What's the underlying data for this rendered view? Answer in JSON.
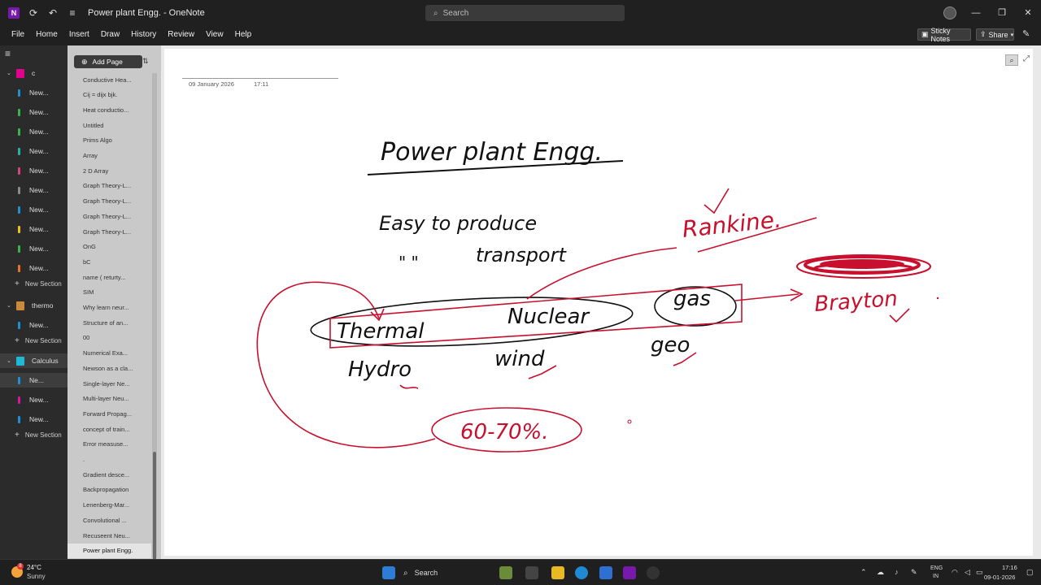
{
  "titlebar": {
    "title": "Power plant Engg. - OneNote",
    "search_placeholder": "Search"
  },
  "menu": [
    "File",
    "Home",
    "Insert",
    "Draw",
    "History",
    "Review",
    "View",
    "Help"
  ],
  "toolbar": {
    "sticky_notes": "Sticky Notes",
    "share": "Share"
  },
  "sections_pane": {
    "notebook_c": {
      "label": "c",
      "color": "#e3008c"
    },
    "c_sections": [
      {
        "label": "New...",
        "color": "#1e90d8"
      },
      {
        "label": "New...",
        "color": "#3cb34a"
      },
      {
        "label": "New...",
        "color": "#3cb34a"
      },
      {
        "label": "New...",
        "color": "#21b3a5"
      },
      {
        "label": "New...",
        "color": "#d9417b"
      },
      {
        "label": "New...",
        "color": "#8a8a8a"
      },
      {
        "label": "New...",
        "color": "#1e90d8"
      },
      {
        "label": "New...",
        "color": "#e6c21b"
      },
      {
        "label": "New...",
        "color": "#3cb34a"
      },
      {
        "label": "New...",
        "color": "#e8722c"
      }
    ],
    "new_section": "New Section",
    "notebook_thermo": {
      "label": "thermo",
      "color": "#c98a3a"
    },
    "thermo_sections": [
      {
        "label": "New...",
        "color": "#1e90d8"
      }
    ],
    "notebook_calculus": {
      "label": "Calculus",
      "color": "#21b8d6"
    },
    "calculus_sections": [
      {
        "label": "Ne...",
        "color": "#1e90d8"
      },
      {
        "label": "New...",
        "color": "#d9179a"
      },
      {
        "label": "New...",
        "color": "#1e90d8"
      }
    ]
  },
  "pages_pane": {
    "add_page": "Add Page",
    "pages": [
      "Conductive Hea...",
      "Cij = dijx bjk.",
      "Heat conductio...",
      "Untitled",
      "Prims Algo",
      "Array",
      "2 D Array",
      "Graph Theory-L...",
      "Graph Theory-L...",
      "Graph Theory-L...",
      "Graph Theory-L...",
      "OnG",
      "bC",
      "name ( returty...",
      "SIM",
      "Why learn neur...",
      "Structure of an...",
      "00",
      "Numerical Exa...",
      "Newson as a cla...",
      "Single-layer Ne...",
      "Multi-layer Neu...",
      "Forward Propag...",
      "concept of train...",
      "Error measuse...",
      ".",
      "Gradient desce...",
      "Backpropagation",
      "Lenenberg-Mar...",
      "Convolutional ...",
      "Recuseent Neu...",
      "Power plant Engg."
    ],
    "selected_index": 31
  },
  "note": {
    "date": "09 January 2026",
    "time": "17:11",
    "ink_text": {
      "title": "Power plant Engg.",
      "line1": "Easy to produce",
      "line2_mark": "\" \"",
      "line2": "transport",
      "thermal": "Thermal",
      "nuclear": "Nuclear",
      "gas": "gas",
      "hydro": "Hydro",
      "wind": "wind",
      "geo": "geo",
      "rankine": "Rankine.",
      "brayton": "Brayton",
      "percent": "60-70%."
    },
    "ink_colors": {
      "black": "#111111",
      "red": "#c8102e"
    }
  },
  "taskbar": {
    "weather_temp": "24°C",
    "weather_cond": "Sunny",
    "weather_badge": "8",
    "search": "Search",
    "lang1": "ENG",
    "lang2": "IN",
    "time": "17:16",
    "date": "09-01-2026"
  }
}
